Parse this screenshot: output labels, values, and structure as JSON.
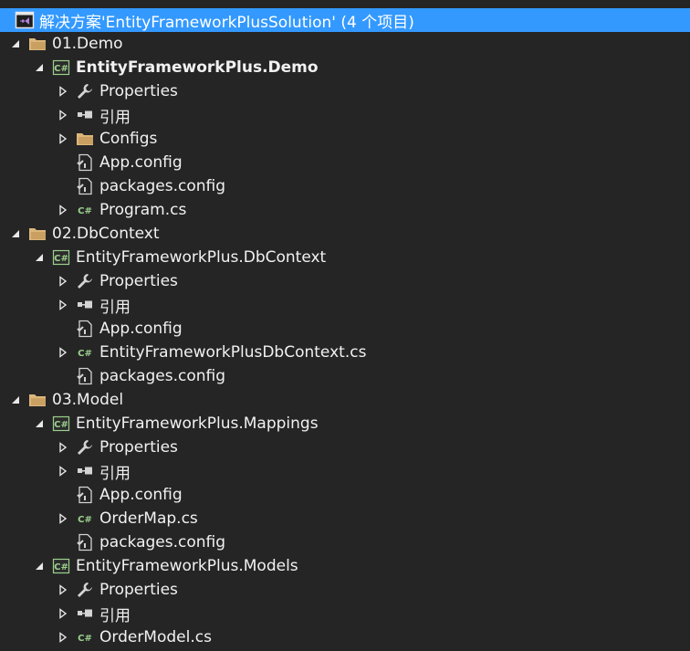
{
  "solution": {
    "label": "解决方案'EntityFrameworkPlusSolution' (4 个项目)",
    "selected": true
  },
  "tree": [
    {
      "label": "01.Demo",
      "depth": 0,
      "toggle": "expanded",
      "icon": "folder-icon"
    },
    {
      "label": "EntityFrameworkPlus.Demo",
      "depth": 1,
      "toggle": "expanded",
      "icon": "csharp-project-icon",
      "bold": true
    },
    {
      "label": "Properties",
      "depth": 2,
      "toggle": "collapsed",
      "icon": "wrench-icon"
    },
    {
      "label": "引用",
      "depth": 2,
      "toggle": "collapsed",
      "icon": "references-icon"
    },
    {
      "label": "Configs",
      "depth": 2,
      "toggle": "collapsed",
      "icon": "folder-icon"
    },
    {
      "label": "App.config",
      "depth": 2,
      "toggle": "none",
      "icon": "config-file-icon"
    },
    {
      "label": "packages.config",
      "depth": 2,
      "toggle": "none",
      "icon": "config-file-icon"
    },
    {
      "label": "Program.cs",
      "depth": 2,
      "toggle": "collapsed",
      "icon": "csharp-file-icon"
    },
    {
      "label": "02.DbContext",
      "depth": 0,
      "toggle": "expanded",
      "icon": "folder-icon"
    },
    {
      "label": "EntityFrameworkPlus.DbContext",
      "depth": 1,
      "toggle": "expanded",
      "icon": "csharp-project-icon"
    },
    {
      "label": "Properties",
      "depth": 2,
      "toggle": "collapsed",
      "icon": "wrench-icon"
    },
    {
      "label": "引用",
      "depth": 2,
      "toggle": "collapsed",
      "icon": "references-icon"
    },
    {
      "label": "App.config",
      "depth": 2,
      "toggle": "none",
      "icon": "config-file-icon"
    },
    {
      "label": "EntityFrameworkPlusDbContext.cs",
      "depth": 2,
      "toggle": "collapsed",
      "icon": "csharp-file-icon"
    },
    {
      "label": "packages.config",
      "depth": 2,
      "toggle": "none",
      "icon": "config-file-icon"
    },
    {
      "label": "03.Model",
      "depth": 0,
      "toggle": "expanded",
      "icon": "folder-icon"
    },
    {
      "label": "EntityFrameworkPlus.Mappings",
      "depth": 1,
      "toggle": "expanded",
      "icon": "csharp-project-icon"
    },
    {
      "label": "Properties",
      "depth": 2,
      "toggle": "collapsed",
      "icon": "wrench-icon"
    },
    {
      "label": "引用",
      "depth": 2,
      "toggle": "collapsed",
      "icon": "references-icon"
    },
    {
      "label": "App.config",
      "depth": 2,
      "toggle": "none",
      "icon": "config-file-icon"
    },
    {
      "label": "OrderMap.cs",
      "depth": 2,
      "toggle": "collapsed",
      "icon": "csharp-file-icon"
    },
    {
      "label": "packages.config",
      "depth": 2,
      "toggle": "none",
      "icon": "config-file-icon"
    },
    {
      "label": "EntityFrameworkPlus.Models",
      "depth": 1,
      "toggle": "expanded",
      "icon": "csharp-project-icon"
    },
    {
      "label": "Properties",
      "depth": 2,
      "toggle": "collapsed",
      "icon": "wrench-icon"
    },
    {
      "label": "引用",
      "depth": 2,
      "toggle": "collapsed",
      "icon": "references-icon"
    },
    {
      "label": "OrderModel.cs",
      "depth": 2,
      "toggle": "collapsed",
      "icon": "csharp-file-icon"
    }
  ],
  "colors": {
    "background": "#252526",
    "selection": "#3399ff",
    "text": "#f1f1f1",
    "folder": "#dcb67a",
    "csharp": "#9bd08c"
  }
}
